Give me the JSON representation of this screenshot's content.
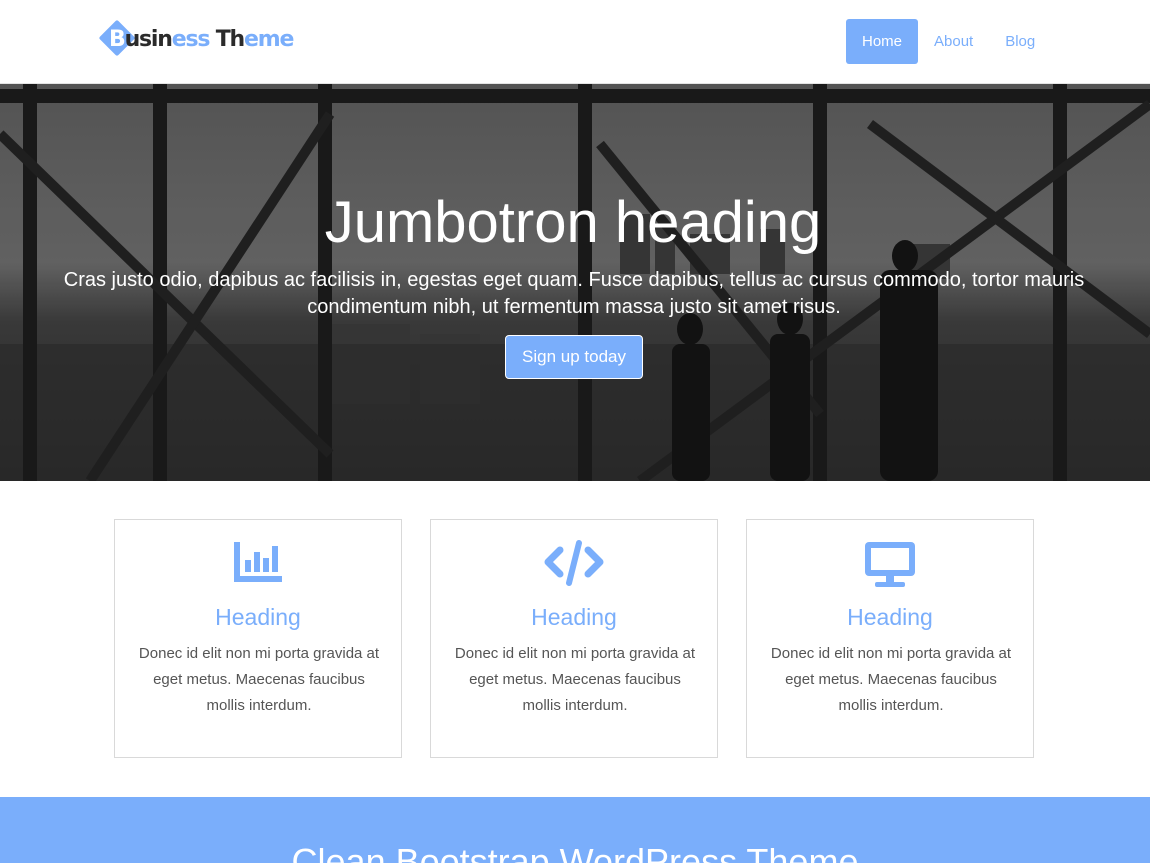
{
  "brand": {
    "name_first": "B",
    "name_part1": "usin",
    "name_part2": "ess",
    "name_part3": " Th",
    "name_part4": "eme",
    "accent_color": "#7aaefb"
  },
  "nav": {
    "items": [
      {
        "label": "Home",
        "active": true
      },
      {
        "label": "About",
        "active": false
      },
      {
        "label": "Blog",
        "active": false
      }
    ]
  },
  "hero": {
    "title": "Jumbotron heading",
    "lead": "Cras justo odio, dapibus ac facilisis in, egestas eget quam. Fusce dapibus, tellus ac cursus commodo, tortor mauris condimentum nibh, ut fermentum massa justo sit amet risus.",
    "button_label": "Sign up today"
  },
  "features": [
    {
      "icon": "bar-chart-icon",
      "heading": "Heading",
      "text": "Donec id elit non mi porta gravida at eget metus. Maecenas faucibus mollis interdum."
    },
    {
      "icon": "code-icon",
      "heading": "Heading",
      "text": "Donec id elit non mi porta gravida at eget metus. Maecenas faucibus mollis interdum."
    },
    {
      "icon": "desktop-icon",
      "heading": "Heading",
      "text": "Donec id elit non mi porta gravida at eget metus. Maecenas faucibus mollis interdum."
    }
  ],
  "band": {
    "title": "Clean Bootstrap WordPress Theme"
  }
}
